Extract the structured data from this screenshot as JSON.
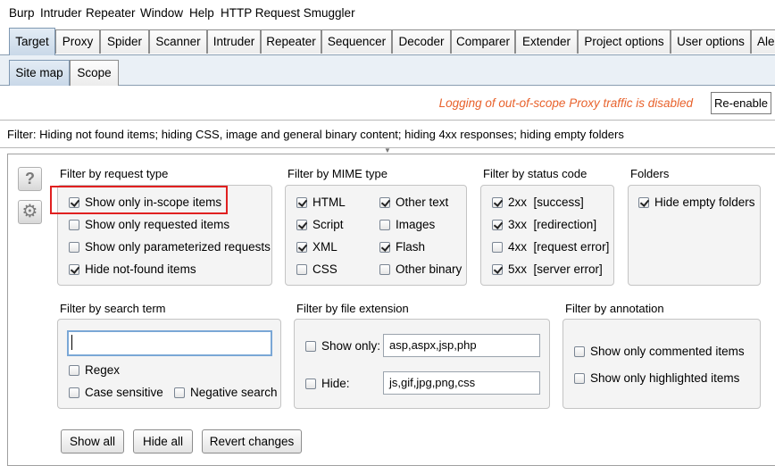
{
  "menu": [
    "Burp",
    "Intruder",
    "Repeater",
    "Window",
    "Help",
    "HTTP Request Smuggler"
  ],
  "tabs": [
    "Target",
    "Proxy",
    "Spider",
    "Scanner",
    "Intruder",
    "Repeater",
    "Sequencer",
    "Decoder",
    "Comparer",
    "Extender",
    "Project options",
    "User options",
    "Ale"
  ],
  "subtabs": [
    "Site map",
    "Scope"
  ],
  "logging": {
    "message": "Logging of out-of-scope Proxy traffic is disabled",
    "button": "Re-enable"
  },
  "filter_bar": {
    "text": "Filter: Hiding not found items;  hiding CSS, image and general binary content;  hiding 4xx responses;  hiding empty folders"
  },
  "icons": {
    "help": "?",
    "settings": "⚙"
  },
  "sections": {
    "request_type": {
      "title": "Filter by request type",
      "items": [
        {
          "label": "Show only in-scope items",
          "checked": true
        },
        {
          "label": "Show only requested items",
          "checked": false
        },
        {
          "label": "Show only parameterized requests",
          "checked": false
        },
        {
          "label": "Hide not-found items",
          "checked": true
        }
      ]
    },
    "mime_type": {
      "title": "Filter by MIME type",
      "items": [
        {
          "label": "HTML",
          "checked": true
        },
        {
          "label": "Other text",
          "checked": true
        },
        {
          "label": "Script",
          "checked": true
        },
        {
          "label": "Images",
          "checked": false
        },
        {
          "label": "XML",
          "checked": true
        },
        {
          "label": "Flash",
          "checked": true
        },
        {
          "label": "CSS",
          "checked": false
        },
        {
          "label": "Other binary",
          "checked": false
        }
      ]
    },
    "status_code": {
      "title": "Filter by status code",
      "items": [
        {
          "code": "2xx",
          "desc": "[success]",
          "checked": true
        },
        {
          "code": "3xx",
          "desc": "[redirection]",
          "checked": true
        },
        {
          "code": "4xx",
          "desc": "[request error]",
          "checked": false
        },
        {
          "code": "5xx",
          "desc": "[server error]",
          "checked": true
        }
      ]
    },
    "folders": {
      "title": "Folders",
      "items": [
        {
          "label": "Hide empty folders",
          "checked": true
        }
      ]
    },
    "search": {
      "title": "Filter by search term",
      "value": "",
      "regex": {
        "label": "Regex",
        "checked": false
      },
      "case": {
        "label": "Case sensitive",
        "checked": false
      },
      "negative": {
        "label": "Negative search",
        "checked": false
      }
    },
    "extension": {
      "title": "Filter by file extension",
      "show_only": {
        "label": "Show only:",
        "checked": false,
        "value": "asp,aspx,jsp,php"
      },
      "hide": {
        "label": "Hide:",
        "checked": false,
        "value": "js,gif,jpg,png,css"
      }
    },
    "annotation": {
      "title": "Filter by annotation",
      "items": [
        {
          "label": "Show only commented items",
          "checked": false
        },
        {
          "label": "Show only highlighted items",
          "checked": false
        }
      ]
    }
  },
  "buttons": {
    "show_all": "Show all",
    "hide_all": "Hide all",
    "revert": "Revert changes"
  }
}
